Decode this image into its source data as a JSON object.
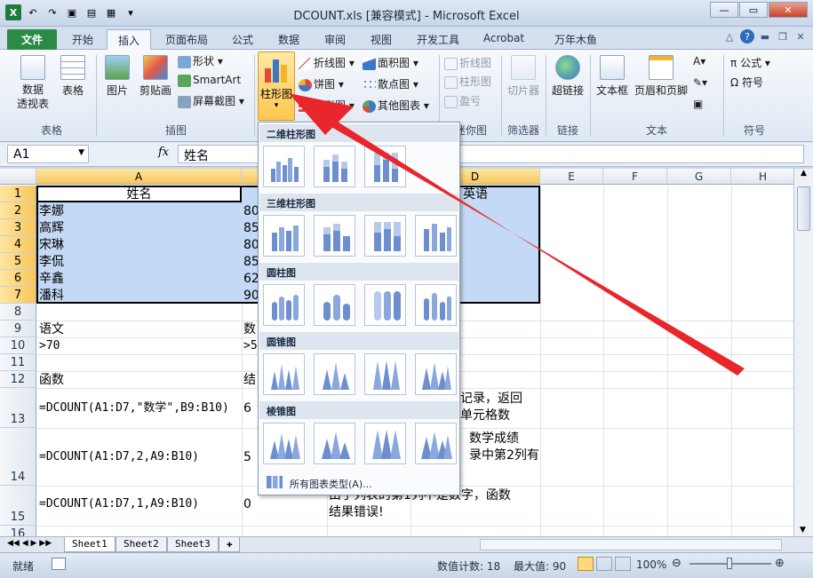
{
  "window": {
    "title": "DCOUNT.xls  [兼容模式] - Microsoft Excel"
  },
  "tabs": [
    "文件",
    "开始",
    "插入",
    "页面布局",
    "公式",
    "数据",
    "审阅",
    "视图",
    "开发工具",
    "Acrobat",
    "万年木鱼"
  ],
  "ribbon": {
    "pivot": "数据\n透视表",
    "table": "表格",
    "picture": "图片",
    "clipart": "剪贴画",
    "shapes": "形状",
    "smartart": "SmartArt",
    "screenshot": "屏幕截图",
    "column_chart": "柱形图",
    "line": "折线图",
    "pie": "饼图",
    "bar": "条形图",
    "area": "面积图",
    "scatter": "散点图",
    "other": "其他图表",
    "spark_line": "折线图",
    "spark_col": "柱形图",
    "spark_wl": "盈亏",
    "slicer": "切片器",
    "hyperlink": "超链接",
    "textbox": "文本框",
    "header_footer": "页眉和页脚",
    "equation": "公式",
    "symbol": "符号",
    "groups": {
      "tables": "表格",
      "illustrations": "插图",
      "sparklines": "迷你图",
      "filter": "筛选器",
      "links": "链接",
      "text": "文本",
      "symbols": "符号"
    }
  },
  "formula_bar": {
    "name_box": "A1",
    "fx": "fx",
    "content": "姓名"
  },
  "columns": [
    "A",
    "B",
    "C",
    "D",
    "E",
    "F",
    "G",
    "H"
  ],
  "rows": [
    "1",
    "2",
    "3",
    "4",
    "5",
    "6",
    "7",
    "8",
    "9",
    "10",
    "11",
    "12",
    "13",
    "14",
    "15",
    "16"
  ],
  "cells": {
    "a1": "姓名",
    "d1": "英语",
    "names": [
      "李娜",
      "高辉",
      "宋琳",
      "李侃",
      "辛鑫",
      "潘科"
    ],
    "b_vals": [
      "80",
      "85",
      "80",
      "85",
      "62",
      "90"
    ],
    "a9": "语文",
    "b9": "数",
    "a10": ">70",
    "b10": ">5",
    "a12": "函数",
    "b12": "结",
    "a13": "=DCOUNT(A1:D7,\"数学\",B9:B10)",
    "b13": "6",
    "c13": "记录，返回\n单元格数",
    "a14": "=DCOUNT(A1:D7,2,A9:B10)",
    "b14": "5",
    "c14": "数学成绩\n录中第2列有",
    "a15": "=DCOUNT(A1:D7,1,A9:B10)",
    "b15": "0",
    "c15": "由于列表的第1列不是数字，函数\n结果错误!"
  },
  "chart_menu": {
    "sec_2d": "二维柱形图",
    "sec_3d": "三维柱形图",
    "sec_cyl": "圆柱图",
    "sec_cone": "圆锥图",
    "sec_pyr": "棱锥图",
    "all": "所有图表类型(A)..."
  },
  "sheets": [
    "Sheet1",
    "Sheet2",
    "Sheet3"
  ],
  "status": {
    "ready": "就绪",
    "count": "数值计数: 18",
    "max": "最大值: 90",
    "zoom": "100%"
  }
}
